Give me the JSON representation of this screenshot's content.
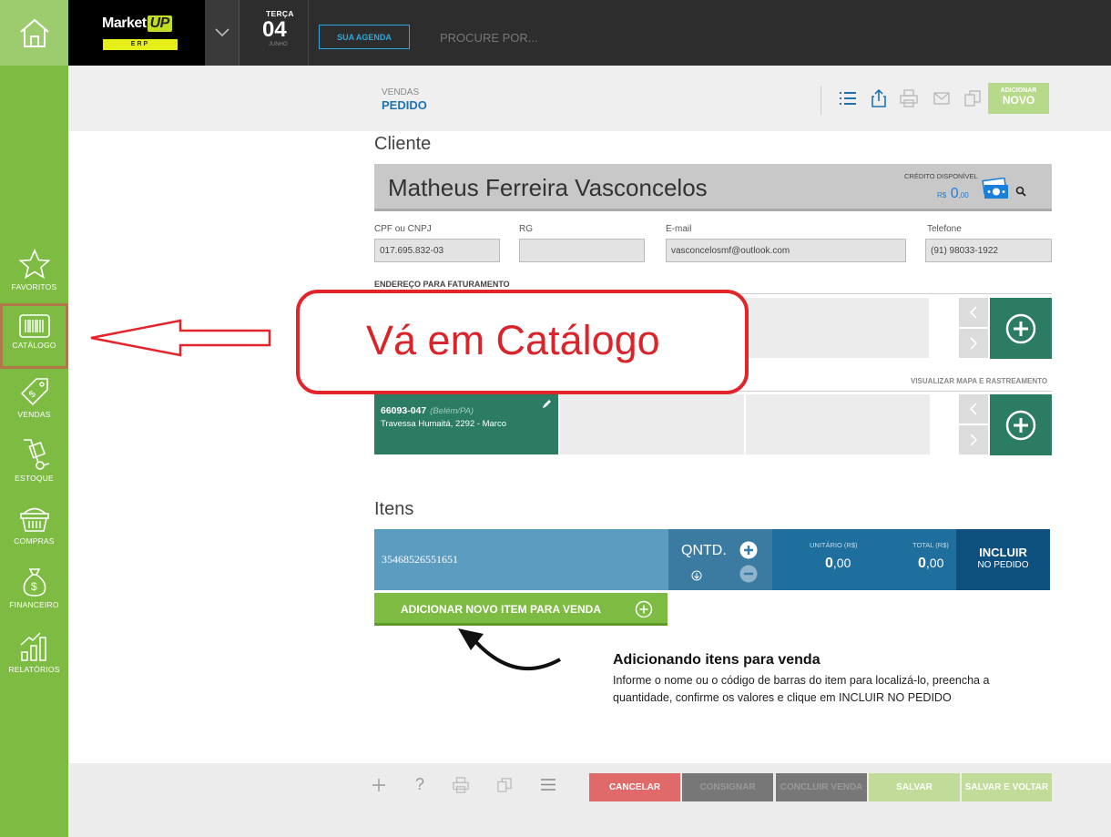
{
  "sidebar": {
    "items": [
      {
        "label": "FAVORITOS"
      },
      {
        "label": "CATÁLOGO"
      },
      {
        "label": "VENDAS"
      },
      {
        "label": "ESTOQUE"
      },
      {
        "label": "COMPRAS"
      },
      {
        "label": "FINANCEIRO"
      },
      {
        "label": "RELATÓRIOS"
      }
    ]
  },
  "topbar": {
    "logo_main": "Market",
    "logo_up": "UP",
    "logo_sub": "ERP",
    "day_of_week": "TERÇA",
    "day": "04",
    "month": "JUNHO",
    "agenda_label": "SUA AGENDA",
    "search_placeholder": "PROCURE POR..."
  },
  "header": {
    "section": "VENDAS",
    "page": "PEDIDO",
    "add_new_top": "ADICIONAR",
    "add_new_bottom": "NOVO"
  },
  "client": {
    "section_title": "Cliente",
    "name": "Matheus Ferreira Vasconcelos",
    "credit_label": "CRÉDITO DISPONÍVEL",
    "credit_currency": "R$",
    "credit_value": "0",
    "credit_cents": ",00",
    "cpf_label": "CPF ou CNPJ",
    "cpf_value": "017.695.832-03",
    "rg_label": "RG",
    "rg_value": "",
    "email_label": "E-mail",
    "email_value": "vasconcelosmf@outlook.com",
    "phone_label": "Telefone",
    "phone_value": "(91) 98033-1922",
    "billing_address_label": "ENDEREÇO PARA FATURAMENTO",
    "map_link": "VISUALIZAR MAPA E RASTREAMENTO",
    "address_zip": "66093-047",
    "address_city": "(Belém/PA)",
    "address_street": "Travessa Humaitá, 2292 - Marco"
  },
  "items": {
    "section_title": "Itens",
    "code": "35468526551651",
    "qty_label": "QNTD.",
    "unit_label": "UNITÁRIO (R$)",
    "unit_value": "0",
    "unit_cents": ",00",
    "total_label": "TOTAL (R$)",
    "total_value": "0",
    "total_cents": ",00",
    "include_top": "INCLUIR",
    "include_bottom": "NO PEDIDO",
    "add_item_label": "ADICIONAR NOVO ITEM PARA VENDA"
  },
  "tip": {
    "title": "Adicionando itens para venda",
    "body": "Informe o nome ou o código de barras do item para localizá-lo, preencha a quantidade, confirme os valores e clique em INCLUIR NO PEDIDO"
  },
  "annotation": {
    "text": "Vá em Catálogo"
  },
  "footer": {
    "cancel": "CANCELAR",
    "consign": "CONSIGNAR",
    "finish": "CONCLUIR VENDA",
    "save": "SALVAR",
    "save_back": "SALVAR E VOLTAR",
    "help": "?"
  },
  "colors": {
    "sidebar_green": "#7dbb42",
    "accent_blue": "#1f74b0",
    "teal": "#2b7c63",
    "cancel_red": "#e06a6a",
    "annotation_red": "#e3242b"
  }
}
